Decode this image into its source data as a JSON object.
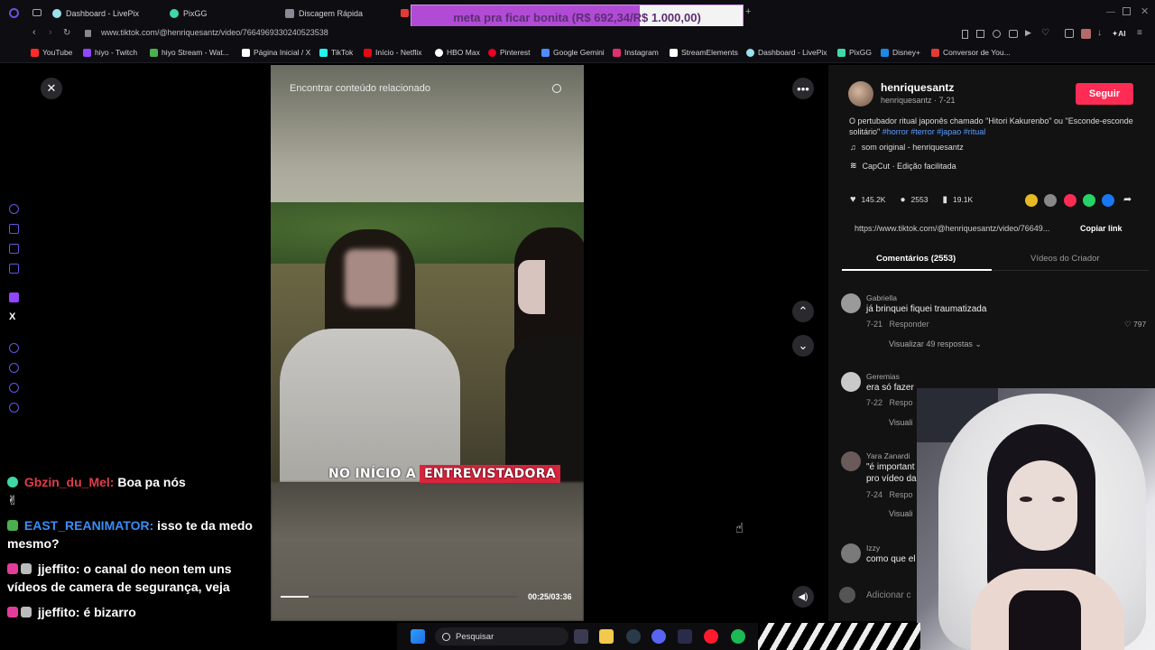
{
  "browser": {
    "tabs": [
      {
        "label": "Dashboard - LivePix",
        "color": "#9be1f0"
      },
      {
        "label": "PixGG",
        "color": "#3ed9a7"
      },
      {
        "label": "Discagem Rápida",
        "color": "#8a8a95"
      }
    ],
    "goal_overlay": {
      "label": "meta pra ficar bonita",
      "current": "(R$ 692,34/",
      "target": "R$ 1.000,00)"
    },
    "url": "www.tiktok.com/@henriquesantz/video/7664969330240523538",
    "bookmarks": [
      {
        "label": "YouTube",
        "color": "#ff2b2b"
      },
      {
        "label": "hiyo - Twitch",
        "color": "#9146ff"
      },
      {
        "label": "hiyo Stream - Wat...",
        "color": "#4caf50"
      },
      {
        "label": "Página Inicial / X",
        "color": "#ffffff"
      },
      {
        "label": "TikTok",
        "color": "#25f4ee"
      },
      {
        "label": "Início - Netflix",
        "color": "#e50914"
      },
      {
        "label": "HBO Max",
        "color": "#ffffff"
      },
      {
        "label": "Pinterest",
        "color": "#e60023"
      },
      {
        "label": "Google Gemini",
        "color": "#4f8cff"
      },
      {
        "label": "Instagram",
        "color": "#e1306c"
      },
      {
        "label": "StreamElements",
        "color": "#ffffff"
      },
      {
        "label": "Dashboard - LivePix",
        "color": "#9be1f0"
      },
      {
        "label": "PixGG",
        "color": "#3ed9a7"
      },
      {
        "label": "Disney+",
        "color": "#1e88e5"
      },
      {
        "label": "Conversor de You...",
        "color": "#e53935"
      }
    ]
  },
  "video": {
    "related_search": "Encontrar conteúdo relacionado",
    "caption_plain": "NO INÍCIO A",
    "caption_highlight": "ENTREVISTADORA",
    "timecode": "00:25/03:36",
    "progress": 0.12
  },
  "post": {
    "username": "henriquesantz",
    "handle": "henriquesantz · 7-21",
    "follow_label": "Seguir",
    "description": "O pertubador ritual japonês chamado \"Hitori Kakurenbo\" ou \"Esconde-esconde solitário\"",
    "hashtags": "#horror #terror #japao #ritual",
    "sound": "som original - henriquesantz",
    "capcut": "CapCut · Edição facilitada",
    "likes": "145.2K",
    "comments": "2553",
    "saves": "19.1K",
    "link": "https://www.tiktok.com/@henriquesantz/video/76649...",
    "copy_link": "Copiar link",
    "tab_comments": "Comentários (2553)",
    "tab_creator": "Vídeos do Criador",
    "add_comment": "Adicionar c"
  },
  "comments": [
    {
      "name": "Gabriella",
      "text": "já brinquei fiquei traumatizada",
      "date": "7-21",
      "reply": "Responder",
      "likes": "797",
      "replies": "Visualizar 49 respostas"
    },
    {
      "name": "Geremias",
      "text": "era só fazer",
      "date": "7-22",
      "reply": "Respo",
      "replies": "Visuali"
    },
    {
      "name": "Yara Zanardi",
      "text": "\"é important",
      "text2": "pro vídeo da",
      "date": "7-24",
      "reply": "Respo",
      "replies": "Visuali"
    },
    {
      "name": "Izzy",
      "text": "como que el",
      "date": "",
      "reply": ""
    }
  ],
  "chat": [
    {
      "user": "Gbzin_du_Mel:",
      "user_color": "red",
      "msg": "Boa pa nós",
      "extra": "✌"
    },
    {
      "user": "EAST_REANIMATOR:",
      "user_color": "blue",
      "msg": "isso te da medo mesmo?"
    },
    {
      "user": "jjeffito:",
      "user_color": "white",
      "msg": "o canal do neon tem uns vídeos de camera de segurança, veja"
    },
    {
      "user": "jjeffito:",
      "user_color": "white",
      "msg": "é bizarro"
    }
  ],
  "taskbar": {
    "search": "Pesquisar"
  }
}
